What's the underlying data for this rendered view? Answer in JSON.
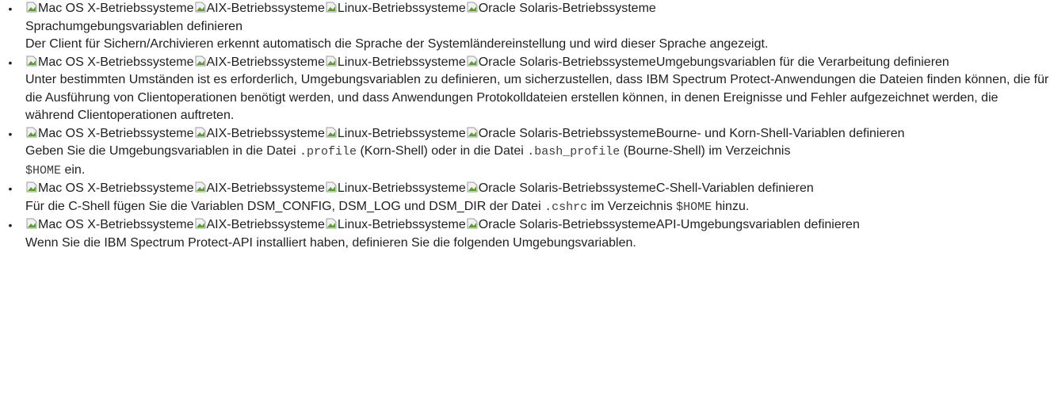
{
  "topics": [
    {
      "os_labels": [
        "Mac OS X-Betriebssysteme",
        "AIX-Betriebssysteme",
        "Linux-Betriebssysteme",
        "Oracle Solaris-Betriebssysteme"
      ],
      "title": "Sprachumgebungsvariablen definieren",
      "desc": {
        "text": "Der Client für Sichern/Archivieren erkennt automatisch die Sprache der Systemländereinstellung und wird dieser Sprache angezeigt."
      }
    },
    {
      "os_labels": [
        "Mac OS X-Betriebssysteme",
        "AIX-Betriebssysteme",
        "Linux-Betriebssysteme",
        "Oracle Solaris-Betriebssysteme"
      ],
      "title": "Umgebungsvariablen für die Verarbeitung definieren",
      "desc": {
        "text": "Unter bestimmten Umständen ist es erforderlich, Umgebungsvariablen zu definieren, um sicherzustellen, dass IBM Spectrum Protect-Anwendungen die Dateien finden können, die für die Ausführung von Clientoperationen benötigt werden, und dass Anwendungen Protokolldateien erstellen können, in denen Ereignisse und Fehler aufgezeichnet werden, die während Clientoperationen auftreten."
      }
    },
    {
      "os_labels": [
        "Mac OS X-Betriebssysteme",
        "AIX-Betriebssysteme",
        "Linux-Betriebssysteme",
        "Oracle Solaris-Betriebssysteme"
      ],
      "title": "Bourne- und Korn-Shell-Variablen definieren",
      "desc": {
        "p1": "Geben Sie die Umgebungsvariablen in die Datei ",
        "c1": ".profile",
        "p2": " (Korn-Shell) oder in die Datei ",
        "c2": ".bash_profile",
        "p3": " (Bourne-Shell) im Verzeichnis ",
        "c3": "$HOME",
        "p4": " ein."
      }
    },
    {
      "os_labels": [
        "Mac OS X-Betriebssysteme",
        "AIX-Betriebssysteme",
        "Linux-Betriebssysteme",
        "Oracle Solaris-Betriebssysteme"
      ],
      "title": "C-Shell-Variablen definieren",
      "desc": {
        "p1": "Für die C-Shell fügen Sie die Variablen DSM_CONFIG, DSM_LOG und DSM_DIR der Datei ",
        "c1": ".cshrc",
        "p2": " im Verzeichnis ",
        "c2": "$HOME",
        "p3": " hinzu."
      }
    },
    {
      "os_labels": [
        "Mac OS X-Betriebssysteme",
        "AIX-Betriebssysteme",
        "Linux-Betriebssysteme",
        "Oracle Solaris-Betriebssysteme"
      ],
      "title": "API-Umgebungsvariablen definieren",
      "desc": {
        "text": "Wenn Sie die IBM Spectrum Protect-API installiert haben, definieren Sie die folgenden Umgebungsvariablen."
      }
    }
  ]
}
